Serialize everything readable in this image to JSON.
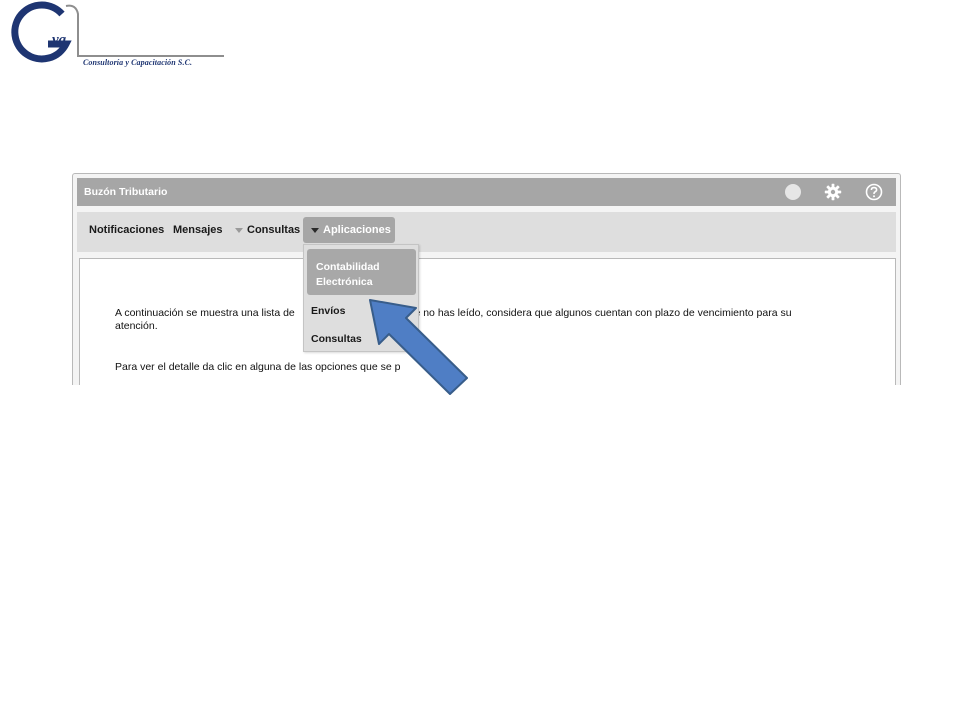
{
  "logo": {
    "letters": "Gva",
    "tagline": "Consultoría y Capacitación S.C.",
    "color": "#1e3572"
  },
  "window": {
    "title": "Buzón Tributario",
    "title_icons": [
      "status-circle-icon",
      "gear-icon",
      "help-icon"
    ]
  },
  "nav": {
    "items": [
      {
        "label": "Notificaciones"
      },
      {
        "label": "Mensajes"
      },
      {
        "label": "Consultas",
        "has_caret": true
      },
      {
        "label": "Aplicaciones",
        "has_caret": true,
        "active": true
      }
    ]
  },
  "content": {
    "paragraph1": "A continuación se muestra una lista de los mensajes que no has leído, considera que algunos cuentan con plazo de vencimiento para su atención.",
    "paragraph1_visible_start": "A continuación se muestra una lista de",
    "paragraph1_visible_end": "que no has leído, considera que algunos cuentan con plazo de vencimiento para su",
    "paragraph1_line2": "atención.",
    "paragraph2_visible_start": "Para ver el detalle da clic en alguna de las opciones que se p",
    "paragraph2_visible_end": ":"
  },
  "dropdown": {
    "items": [
      {
        "label_line1": "Contabilidad",
        "label_line2": "Electrónica",
        "selected": true
      },
      {
        "label": "Envíos"
      },
      {
        "label": "Consultas"
      }
    ]
  },
  "colors": {
    "title_bar": "#a6a6a6",
    "nav_bar": "#dedede",
    "arrow_fill": "#4f7ec5",
    "arrow_stroke": "#385d8a"
  }
}
